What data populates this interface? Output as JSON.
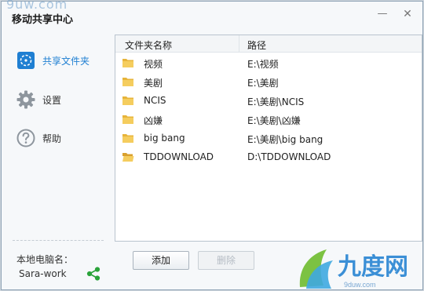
{
  "window": {
    "title": "移动共享中心",
    "watermark": "9uw.com",
    "minimize_glyph": "—",
    "close_glyph": "✕"
  },
  "sidebar": {
    "items": [
      {
        "label": "共享文件夹",
        "icon": "shared-folder-icon",
        "active": true
      },
      {
        "label": "设置",
        "icon": "gear-icon",
        "active": false
      },
      {
        "label": "帮助",
        "icon": "help-icon",
        "active": false
      }
    ],
    "pc_label": "本地电脑名：",
    "pc_name": "Sara-work"
  },
  "table": {
    "headers": {
      "name": "文件夹名称",
      "path": "路径"
    },
    "rows": [
      {
        "name": "视频",
        "path": "E:\\视频"
      },
      {
        "name": "美剧",
        "path": "E:\\美剧"
      },
      {
        "name": "NCIS",
        "path": "E:\\美剧\\NCIS"
      },
      {
        "name": "凶嫌",
        "path": "E:\\美剧\\凶嫌"
      },
      {
        "name": "big bang",
        "path": "E:\\美剧\\big bang"
      },
      {
        "name": "TDDOWNLOAD",
        "path": "D:\\TDDOWNLOAD"
      }
    ]
  },
  "buttons": {
    "add": "添加",
    "delete": "删除"
  },
  "logo": {
    "text": "九度网",
    "url_text": "9duw.com"
  },
  "colors": {
    "accent": "#1f7fd2",
    "share_green": "#2aa33a",
    "folder": "#e7b43a"
  }
}
